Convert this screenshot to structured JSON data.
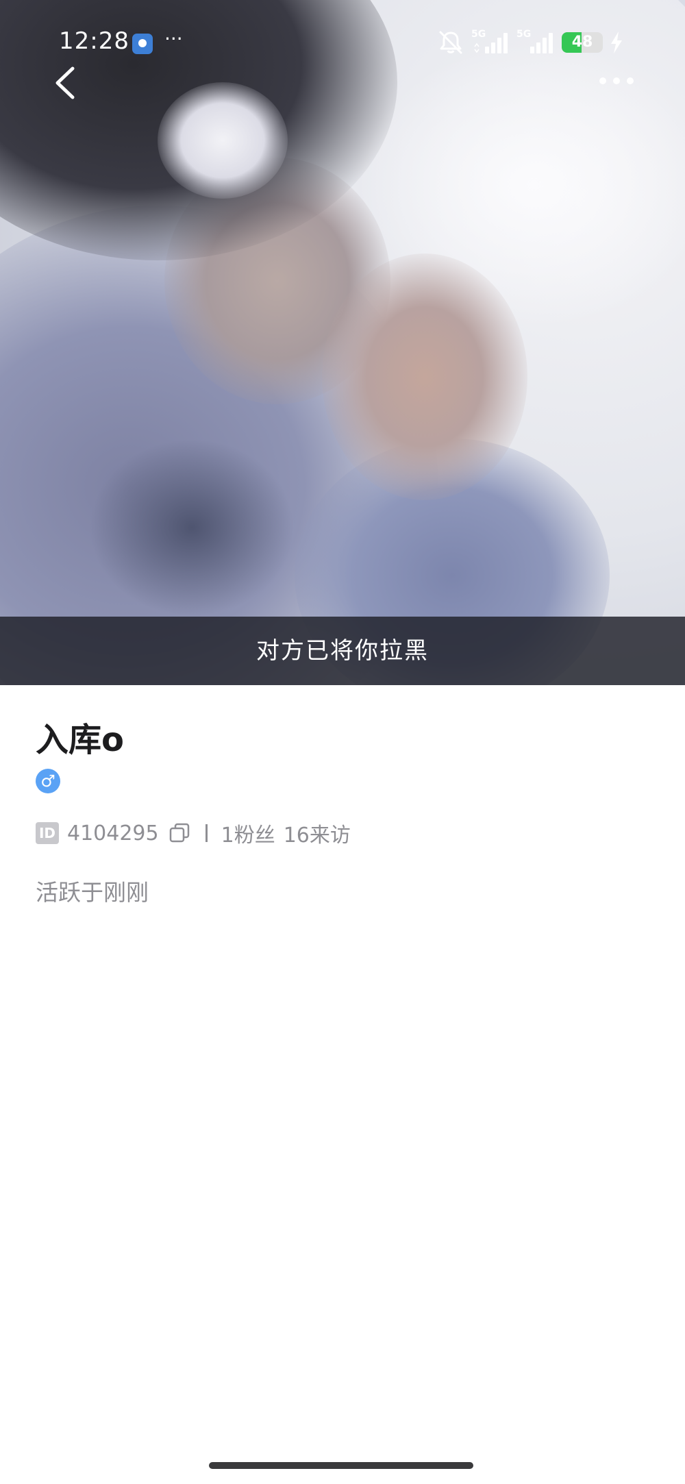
{
  "status_bar": {
    "time": "12:28",
    "more_glyph": "···",
    "network_1": "5G",
    "network_2": "5G",
    "battery_level": "48",
    "battery_fraction": 0.48,
    "icons": [
      "app-notification-icon",
      "mute-icon",
      "signal-icon",
      "signal-icon",
      "battery-icon",
      "charging-bolt-icon"
    ]
  },
  "header": {
    "back_icon": "chevron-left-icon",
    "more_icon": "more-horizontal-icon"
  },
  "cover": {
    "blocked_notice": "对方已将你拉黑"
  },
  "profile": {
    "nickname": "入库o",
    "gender_symbol": "♂",
    "id_label": "ID",
    "id_value": "4104295",
    "fans": "1粉丝",
    "visitors": "16来访",
    "active_status": "活跃于刚刚"
  },
  "colors": {
    "gender_badge": "#5aa2f5",
    "battery_fill": "#35c755",
    "secondary_text": "#8e8e93",
    "title_text": "#1d1d1f"
  }
}
